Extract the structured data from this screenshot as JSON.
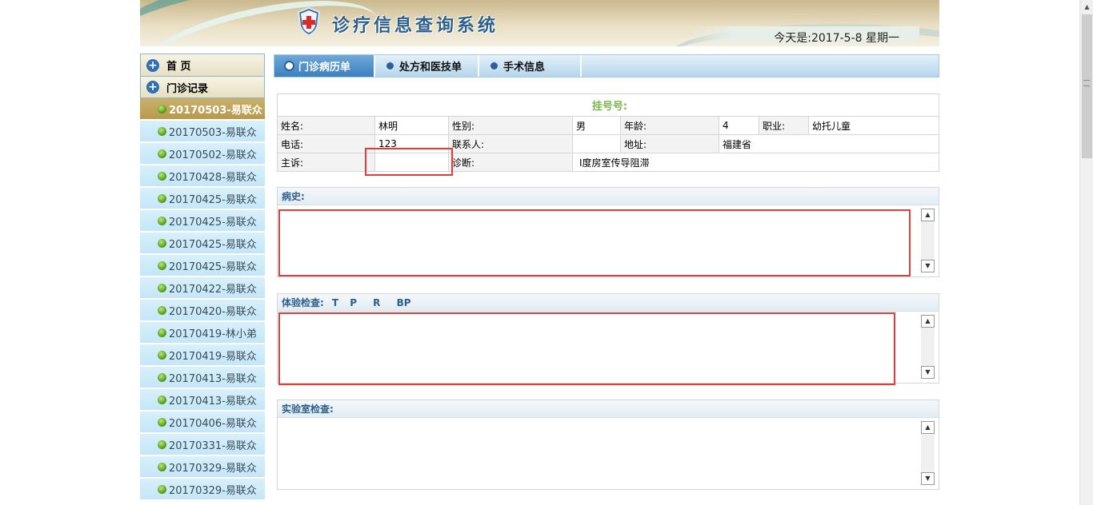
{
  "header": {
    "title": "诊疗信息查询系统",
    "date_text": "今天是:2017-5-8 星期一"
  },
  "sidebar": {
    "home_label": "首 页",
    "records_label": "门诊记录",
    "items": [
      {
        "label": "20170503-易联众",
        "active": true
      },
      {
        "label": "20170503-易联众"
      },
      {
        "label": "20170502-易联众"
      },
      {
        "label": "20170428-易联众"
      },
      {
        "label": "20170425-易联众"
      },
      {
        "label": "20170425-易联众"
      },
      {
        "label": "20170425-易联众"
      },
      {
        "label": "20170425-易联众"
      },
      {
        "label": "20170422-易联众"
      },
      {
        "label": "20170420-易联众"
      },
      {
        "label": "20170419-林小弟"
      },
      {
        "label": "20170419-易联众"
      },
      {
        "label": "20170413-易联众"
      },
      {
        "label": "20170413-易联众"
      },
      {
        "label": "20170406-易联众"
      },
      {
        "label": "20170331-易联众"
      },
      {
        "label": "20170329-易联众"
      },
      {
        "label": "20170329-易联众"
      }
    ]
  },
  "tabs": [
    {
      "label": "门诊病历单",
      "active": true
    },
    {
      "label": "处方和医技单"
    },
    {
      "label": "手术信息"
    }
  ],
  "patient": {
    "registration_label": "挂号号:",
    "name_label": "姓名:",
    "name_value": "林明",
    "gender_label": "性别:",
    "gender_value": "男",
    "age_label": "年龄:",
    "age_value": "4",
    "occupation_label": "职业:",
    "occupation_value": "幼托儿童",
    "phone_label": "电话:",
    "phone_value": "123",
    "contact_label": "联系人:",
    "contact_value": "",
    "address_label": "地址:",
    "address_value": "福建省",
    "complaint_label": "主诉:",
    "complaint_value": "",
    "diagnosis_label": "诊断:",
    "diagnosis_value": "Ⅰ度房室传导阻滞"
  },
  "sections": {
    "history": {
      "title": "病史:",
      "content": ""
    },
    "physical": {
      "title": "体验检查:",
      "vitals": [
        "T",
        "P",
        "R",
        "BP"
      ],
      "content": ""
    },
    "lab": {
      "title": "实验室检查:",
      "content": ""
    }
  },
  "colors": {
    "accent_blue": "#3c7fc0",
    "active_item": "#b9994d",
    "highlight_red": "#e03c3c",
    "registration_green": "#7ab64a"
  }
}
